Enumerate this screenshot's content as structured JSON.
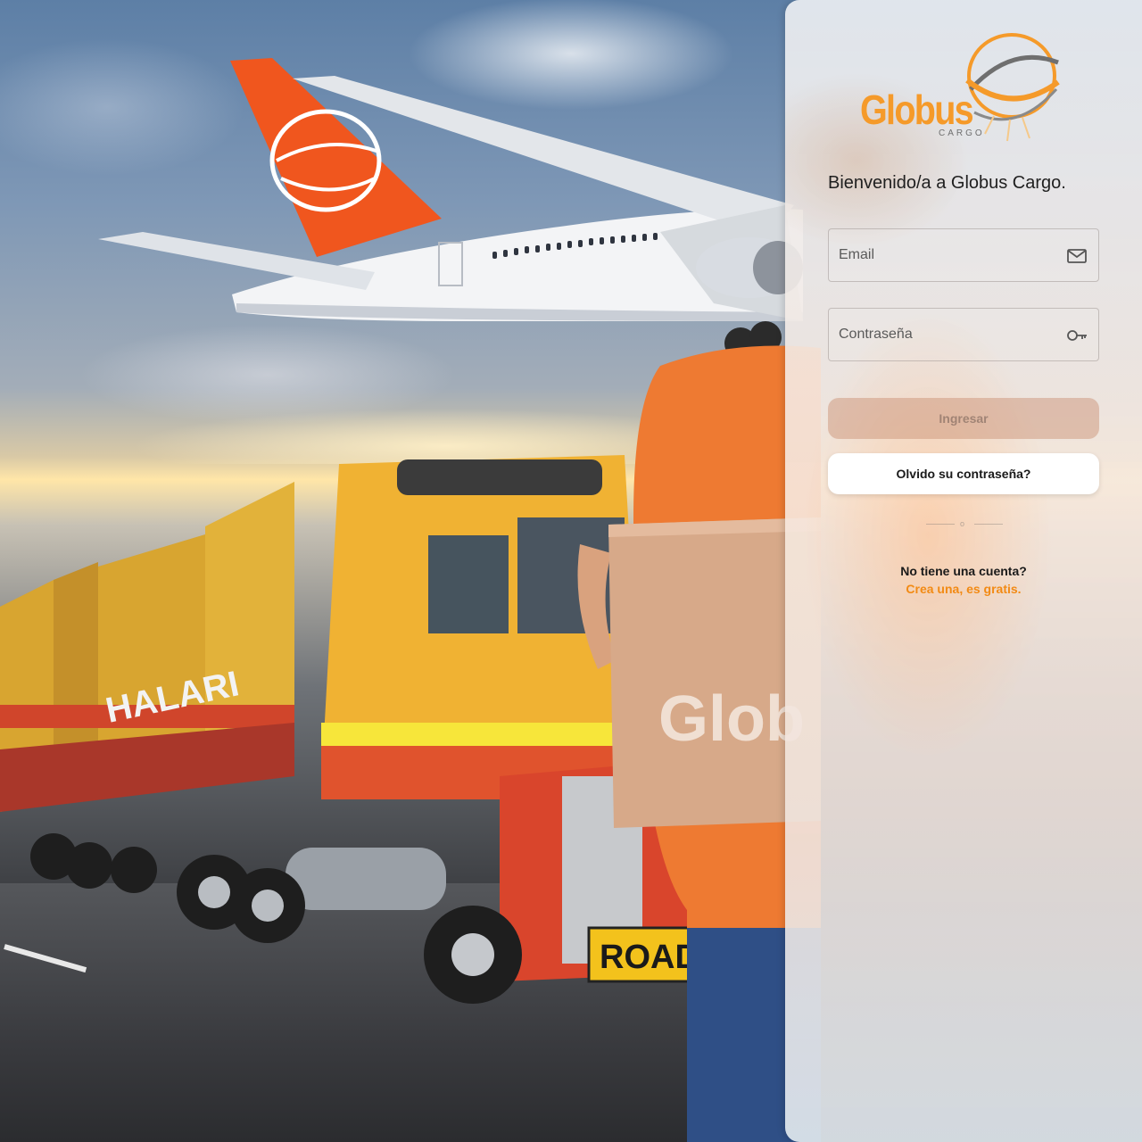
{
  "brand": {
    "name": "Globus",
    "subtitle": "CARGO",
    "accent_color": "#f59a2a"
  },
  "background": {
    "truck_plate": "ROAD",
    "trailer_text": "HALARI",
    "box_text": "Glob"
  },
  "login": {
    "welcome": "Bienvenido/a a Globus Cargo.",
    "email_placeholder": "Email",
    "email_icon": "mail-icon",
    "password_placeholder": "Contraseña",
    "password_icon": "key-icon",
    "submit_label": "Ingresar",
    "forgot_label": "Olvido su contraseña?",
    "divider_text": "o",
    "no_account_text": "No tiene una cuenta?",
    "signup_link": "Crea una, es gratis."
  }
}
